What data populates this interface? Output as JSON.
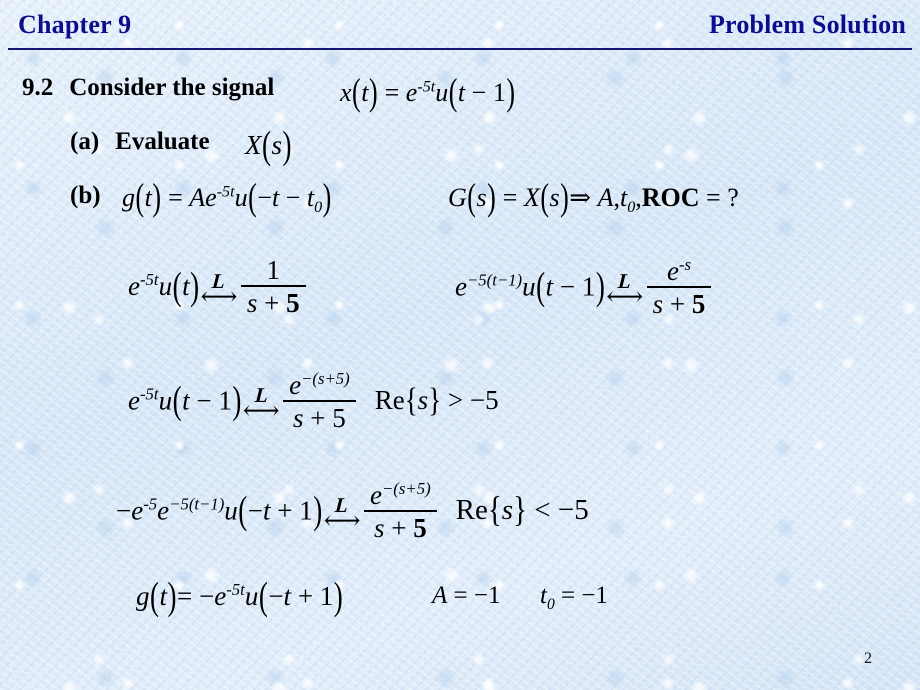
{
  "header": {
    "left_title": "Chapter 9",
    "right_title": "Problem Solution",
    "title_color": "#0d0d8c",
    "rule_color": "#151573"
  },
  "slide": {
    "background_color": "#dce9f8",
    "page_number": "2"
  },
  "problem": {
    "number": "9.2",
    "statement_label": "Consider the signal",
    "statement_math": "x(t) = e^{-5t} u(t-1)",
    "parts": [
      {
        "label": "(a)",
        "text": "Evaluate",
        "math": "X(s)"
      },
      {
        "label": "(b)",
        "math": "g(t) = Ae^{-5t} u(-t-t_0)",
        "math2": "G(s) = X(s) \\Rightarrow A, t_0, ROC = ?"
      }
    ]
  },
  "symbols": {
    "x": "x",
    "t": "t",
    "e": "e",
    "u": "u",
    "s": "s",
    "g": "g",
    "A": "A",
    "X": "X",
    "G": "G",
    "t0_base": "t",
    "t0_sub": "0",
    "equals": "=",
    "minus": "−",
    "plus": "+",
    "implies": "⇒",
    "comma": ",",
    "question": "?",
    "roc": "ROC",
    "laplace": "L",
    "arrow_left": "←",
    "arrow_right": "→",
    "arrow_both": "⟷",
    "lparen": "(",
    "rparen": ")",
    "lbrace": "{",
    "rbrace": "}",
    "gt": ">",
    "lt": "<",
    "re": "Re",
    "exp_minus5t": "-5t",
    "exp_minus5": "-5",
    "exp_minus_s": "-s",
    "five": "5",
    "one": "1",
    "n_one": "1"
  },
  "equations": [
    {
      "id": "eq-row1-left",
      "lhs": "e^{-5t} u(t)",
      "transform": "L",
      "rhs_numerator": "1",
      "rhs_denominator": "s + 5"
    },
    {
      "id": "eq-row1-right",
      "lhs": "e^{-5(t-1)} u(t-1)",
      "transform": "L",
      "rhs_numerator": "e^{-s}",
      "rhs_denominator": "s + 5"
    },
    {
      "id": "eq-row2",
      "lhs": "e^{-5t} u(t-1)",
      "transform": "L",
      "rhs_numerator": "e^{-(s+5)}",
      "rhs_denominator": "s + 5",
      "roc": "Re{s} > -5"
    },
    {
      "id": "eq-row3",
      "lhs": "-e^{-5} e^{-5(t-1)} u(-t+1)",
      "transform": "L",
      "rhs_numerator": "e^{-(s+5)}",
      "rhs_denominator": "s + 5",
      "roc": "Re{s} < -5"
    },
    {
      "id": "eq-row4",
      "lhs": "g(t) = -e^{-5t} u(-t+1)",
      "result_A": "A = -1",
      "result_t0": "t_0 = -1"
    }
  ]
}
